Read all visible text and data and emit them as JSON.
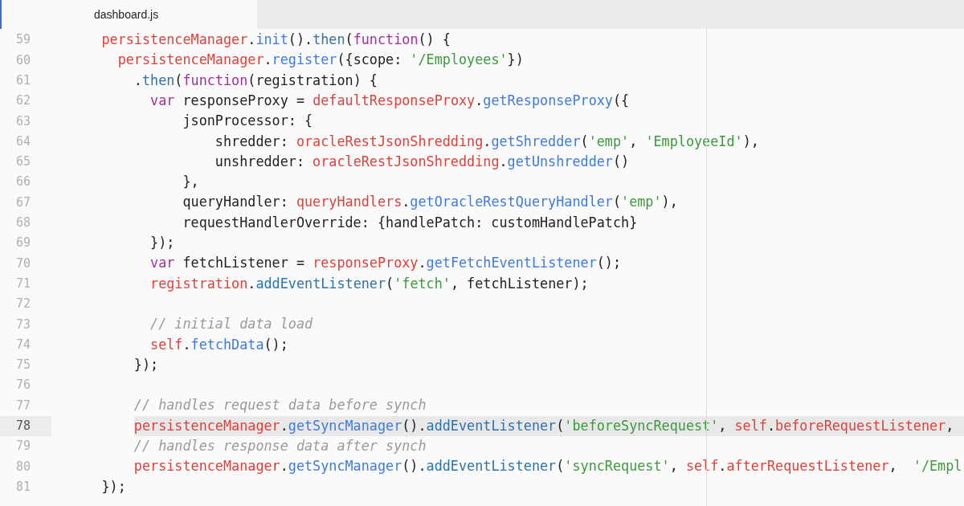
{
  "tabs": [
    {
      "label": "dashboard.js",
      "selected": true
    }
  ],
  "lines": [
    {
      "number": "59",
      "current": false,
      "tokens": [
        {
          "kind": "variable",
          "text": "    persistenceManager"
        },
        {
          "kind": "method",
          "text": ".init"
        },
        {
          "kind": "plain",
          "text": "()."
        },
        {
          "kind": "builtin",
          "text": "then"
        },
        {
          "kind": "plain",
          "text": "("
        },
        {
          "kind": "keyword",
          "text": "function"
        },
        {
          "kind": "plain",
          "text": "() {"
        }
      ]
    },
    {
      "number": "60",
      "current": false,
      "tokens": [
        {
          "kind": "variable",
          "text": "      persistenceManager"
        },
        {
          "kind": "method",
          "text": ".register"
        },
        {
          "kind": "plain",
          "text": "({scope: "
        },
        {
          "kind": "string",
          "text": "'/Employees'"
        },
        {
          "kind": "plain",
          "text": "})"
        }
      ]
    },
    {
      "number": "61",
      "current": false,
      "tokens": [
        {
          "kind": "plain",
          "text": "        ."
        },
        {
          "kind": "builtin",
          "text": "then"
        },
        {
          "kind": "plain",
          "text": "("
        },
        {
          "kind": "keyword",
          "text": "function"
        },
        {
          "kind": "plain",
          "text": "(registration) {"
        }
      ]
    },
    {
      "number": "62",
      "current": false,
      "tokens": [
        {
          "kind": "keyword",
          "text": "          var"
        },
        {
          "kind": "plain",
          "text": " responseProxy = "
        },
        {
          "kind": "variable",
          "text": "defaultResponseProxy"
        },
        {
          "kind": "method",
          "text": ".getResponseProxy"
        },
        {
          "kind": "plain",
          "text": "({"
        }
      ]
    },
    {
      "number": "63",
      "current": false,
      "tokens": [
        {
          "kind": "plain",
          "text": "              jsonProcessor: {"
        }
      ]
    },
    {
      "number": "64",
      "current": false,
      "tokens": [
        {
          "kind": "plain",
          "text": "                  shredder: "
        },
        {
          "kind": "variable",
          "text": "oracleRestJsonShredding"
        },
        {
          "kind": "method",
          "text": ".getShredder"
        },
        {
          "kind": "plain",
          "text": "("
        },
        {
          "kind": "string",
          "text": "'emp'"
        },
        {
          "kind": "plain",
          "text": ", "
        },
        {
          "kind": "string",
          "text": "'EmployeeId'"
        },
        {
          "kind": "plain",
          "text": "),"
        }
      ]
    },
    {
      "number": "65",
      "current": false,
      "tokens": [
        {
          "kind": "plain",
          "text": "                  unshredder: "
        },
        {
          "kind": "variable",
          "text": "oracleRestJsonShredding"
        },
        {
          "kind": "method",
          "text": ".getUnshredder"
        },
        {
          "kind": "plain",
          "text": "()"
        }
      ]
    },
    {
      "number": "66",
      "current": false,
      "tokens": [
        {
          "kind": "plain",
          "text": "              },"
        }
      ]
    },
    {
      "number": "67",
      "current": false,
      "tokens": [
        {
          "kind": "plain",
          "text": "              queryHandler: "
        },
        {
          "kind": "variable",
          "text": "queryHandlers"
        },
        {
          "kind": "method",
          "text": ".getOracleRestQueryHandler"
        },
        {
          "kind": "plain",
          "text": "("
        },
        {
          "kind": "string",
          "text": "'emp'"
        },
        {
          "kind": "plain",
          "text": "),"
        }
      ]
    },
    {
      "number": "68",
      "current": false,
      "tokens": [
        {
          "kind": "plain",
          "text": "              requestHandlerOverride: {handlePatch: customHandlePatch}"
        }
      ]
    },
    {
      "number": "69",
      "current": false,
      "tokens": [
        {
          "kind": "plain",
          "text": "          });"
        }
      ]
    },
    {
      "number": "70",
      "current": false,
      "tokens": [
        {
          "kind": "keyword",
          "text": "          var"
        },
        {
          "kind": "plain",
          "text": " fetchListener = "
        },
        {
          "kind": "variable",
          "text": "responseProxy"
        },
        {
          "kind": "method",
          "text": ".getFetchEventListener"
        },
        {
          "kind": "plain",
          "text": "();"
        }
      ]
    },
    {
      "number": "71",
      "current": false,
      "tokens": [
        {
          "kind": "variable",
          "text": "          registration"
        },
        {
          "kind": "builtin",
          "text": ".addEventListener"
        },
        {
          "kind": "plain",
          "text": "("
        },
        {
          "kind": "string",
          "text": "'fetch'"
        },
        {
          "kind": "plain",
          "text": ", fetchListener);"
        }
      ]
    },
    {
      "number": "72",
      "current": false
    },
    {
      "number": "73",
      "current": false,
      "tokens": [
        {
          "kind": "comment",
          "text": "          // initial data load"
        }
      ]
    },
    {
      "number": "74",
      "current": false,
      "tokens": [
        {
          "kind": "variable",
          "text": "          self"
        },
        {
          "kind": "method",
          "text": ".fetchData"
        },
        {
          "kind": "plain",
          "text": "();"
        }
      ]
    },
    {
      "number": "75",
      "current": false,
      "tokens": [
        {
          "kind": "plain",
          "text": "        });"
        }
      ]
    },
    {
      "number": "76",
      "current": false
    },
    {
      "number": "77",
      "current": false,
      "tokens": [
        {
          "kind": "comment",
          "text": "        // handles request data before synch"
        }
      ]
    },
    {
      "number": "78",
      "current": true,
      "tokens": [
        {
          "kind": "variable",
          "text": "        persistenceManager"
        },
        {
          "kind": "method",
          "text": ".getSyncManager"
        },
        {
          "kind": "plain",
          "text": "()."
        },
        {
          "kind": "builtin",
          "text": "addEventListener"
        },
        {
          "kind": "plain",
          "text": "("
        },
        {
          "kind": "string",
          "text": "'beforeSyncRequest'"
        },
        {
          "kind": "plain",
          "text": ", "
        },
        {
          "kind": "variable",
          "text": "self"
        },
        {
          "kind": "variable",
          "text": ".beforeRequestListener"
        },
        {
          "kind": "plain",
          "text": ","
        }
      ]
    },
    {
      "number": "79",
      "current": false,
      "tokens": [
        {
          "kind": "comment",
          "text": "        // handles response data after synch"
        }
      ]
    },
    {
      "number": "80",
      "current": false,
      "tokens": [
        {
          "kind": "variable",
          "text": "        persistenceManager"
        },
        {
          "kind": "method",
          "text": ".getSyncManager"
        },
        {
          "kind": "plain",
          "text": "()."
        },
        {
          "kind": "builtin",
          "text": "addEventListener"
        },
        {
          "kind": "plain",
          "text": "("
        },
        {
          "kind": "string",
          "text": "'syncRequest'"
        },
        {
          "kind": "plain",
          "text": ", "
        },
        {
          "kind": "variable",
          "text": "self"
        },
        {
          "kind": "variable",
          "text": ".afterRequestListener"
        },
        {
          "kind": "plain",
          "text": ",  "
        },
        {
          "kind": "string",
          "text": "'/Empl"
        }
      ]
    },
    {
      "number": "81",
      "current": false,
      "tokens": [
        {
          "kind": "plain",
          "text": "    });"
        }
      ]
    }
  ]
}
